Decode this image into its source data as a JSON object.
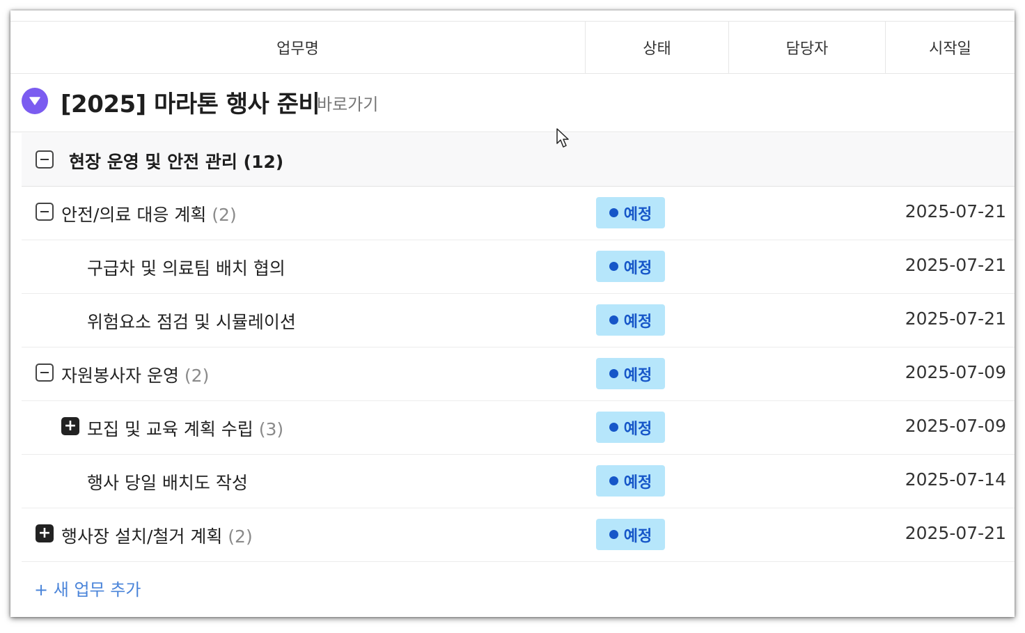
{
  "header": {
    "columns": [
      "업무명",
      "상태",
      "담당자",
      "시작일"
    ]
  },
  "project": {
    "title": "[2025] 마라톤 행사 준비",
    "link_label": "바로가기",
    "icon": "chevron-down-icon",
    "icon_color": "#7b5cf0"
  },
  "group": {
    "title": "현장 운영 및 안전 관리 (12)",
    "icon": "collapse-icon"
  },
  "tasks": [
    {
      "name": "안전/의료 대응 계획",
      "count": "(2)",
      "status": "예정",
      "start": "2025-07-21",
      "toggle": "minus",
      "level": 1
    },
    {
      "name": "구급차 및 의료팀 배치 협의",
      "count": "",
      "status": "예정",
      "start": "2025-07-21",
      "toggle": "",
      "level": 2
    },
    {
      "name": "위험요소 점검 및 시뮬레이션",
      "count": "",
      "status": "예정",
      "start": "2025-07-21",
      "toggle": "",
      "level": 2
    },
    {
      "name": "자원봉사자 운영",
      "count": "(2)",
      "status": "예정",
      "start": "2025-07-09",
      "toggle": "minus",
      "level": 1
    },
    {
      "name": "모집 및 교육 계획 수립",
      "count": "(3)",
      "status": "예정",
      "start": "2025-07-09",
      "toggle": "plus",
      "level": 2
    },
    {
      "name": "행사 당일 배치도 작성",
      "count": "",
      "status": "예정",
      "start": "2025-07-14",
      "toggle": "",
      "level": 2
    },
    {
      "name": "행사장 설치/철거 계획",
      "count": "(2)",
      "status": "예정",
      "start": "2025-07-21",
      "toggle": "plus",
      "level": 1
    }
  ],
  "add_task_label": "+ 새 업무 추가",
  "colors": {
    "status_bg": "#b6e6fb",
    "status_text": "#1656c8",
    "link": "#4a84d9"
  }
}
